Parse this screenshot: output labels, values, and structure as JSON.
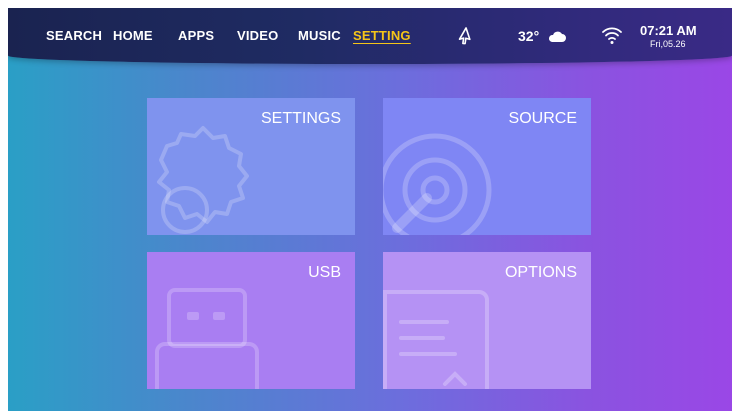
{
  "nav": {
    "items": [
      {
        "label": "SEARCH"
      },
      {
        "label": "HOME"
      },
      {
        "label": "APPS"
      },
      {
        "label": "VIDEO"
      },
      {
        "label": "MUSIC"
      },
      {
        "label": "SETTING",
        "active": true
      }
    ]
  },
  "status": {
    "temperature": "32°",
    "weather_icon": "cloud-icon",
    "cursor_icon": "mouse-cursor-icon",
    "wifi_icon": "wifi-icon",
    "time": "07:21 AM",
    "date": "Fri,05.26"
  },
  "tiles": [
    {
      "label": "SETTINGS",
      "icon": "gear-icon"
    },
    {
      "label": "SOURCE",
      "icon": "source-disc-icon"
    },
    {
      "label": "USB",
      "icon": "usb-drive-icon"
    },
    {
      "label": "OPTIONS",
      "icon": "document-icon"
    }
  ],
  "colors": {
    "active_nav": "#f5c518",
    "tile_settings": "#7f93ee",
    "tile_source": "#7f86f4",
    "tile_usb": "#a97ef2",
    "tile_options": "#b592f4"
  }
}
